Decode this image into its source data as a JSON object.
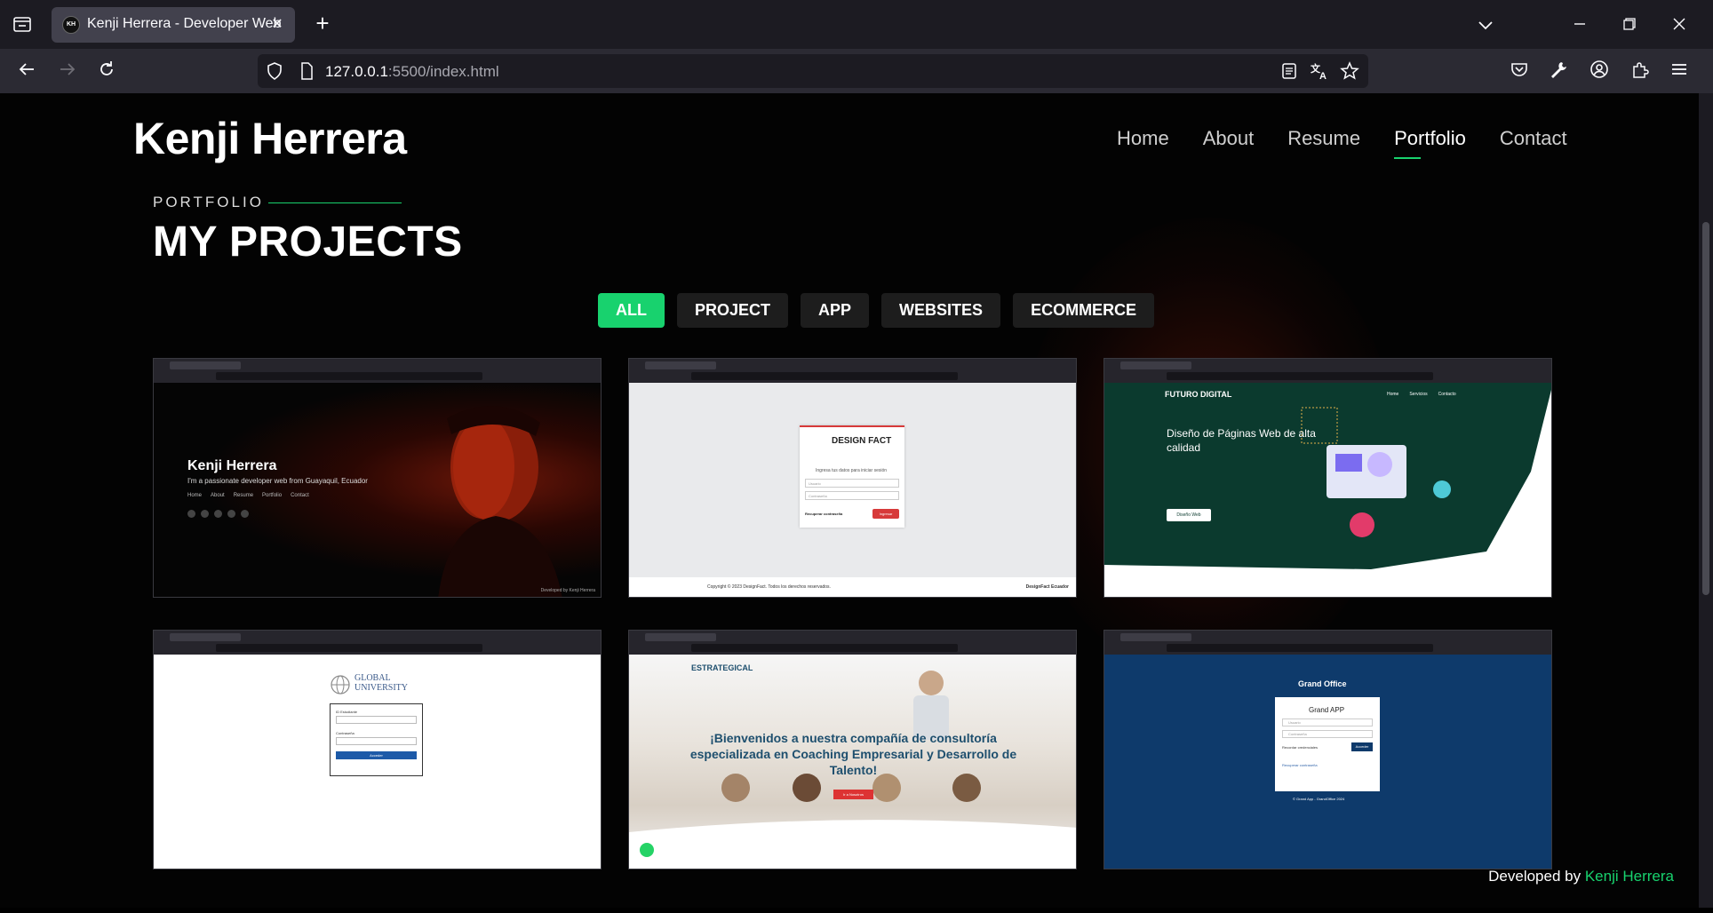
{
  "browser": {
    "tab_title": "Kenji Herrera - Developer Web",
    "favicon_text": "KH",
    "url_host": "127.0.0.1",
    "url_path": ":5500/index.html"
  },
  "site": {
    "brand": "Kenji Herrera",
    "nav": [
      "Home",
      "About",
      "Resume",
      "Portfolio",
      "Contact"
    ],
    "active_nav": "Portfolio"
  },
  "portfolio": {
    "subtitle": "PORTFOLIO",
    "title": "MY PROJECTS",
    "filters": [
      "ALL",
      "PROJECT",
      "APP",
      "WEBSITES",
      "ECOMMERCE"
    ],
    "active_filter": "ALL"
  },
  "projects": [
    {
      "name": "Kenji Herrera",
      "tagline": "I'm a passionate developer web from Guayaquil, Ecuador",
      "links": [
        "Home",
        "About",
        "Resume",
        "Portfolio",
        "Contact"
      ],
      "credit": "Developed by Kenji Herrera"
    },
    {
      "logo": "DESIGN FACT",
      "prompt": "Ingresa tus datos para iniciar sesión",
      "user": "Usuario",
      "password": "Contraseña",
      "recover": "Recuperar contraseña",
      "submit": "Ingresar",
      "footer": "Copyright © 2023 DesignFact. Todos los derechos reservados.",
      "footer_right": "DesignFact Ecuador"
    },
    {
      "logo": "FUTURO DIGITAL",
      "menu": [
        "Home",
        "Servicios",
        "Contacto"
      ],
      "headline": "Diseño de Páginas Web de alta calidad",
      "cta": "Diseño Web"
    },
    {
      "logo": "GLOBAL UNIVERSITY",
      "field1": "ID Estudiante",
      "field2": "Contraseña",
      "submit": "Acceder"
    },
    {
      "logo": "ESTRATEGICAL",
      "headline": "¡Bienvenidos a nuestra compañía de consultoría especializada en Coaching Empresarial y Desarrollo de Talento!",
      "cta": "Ir a Nosotros"
    },
    {
      "logo": "Grand Office",
      "heading": "Grand APP",
      "user": "Usuario",
      "password": "Contraseña",
      "remember": "Recordar credenciales",
      "submit": "Acceder",
      "recover": "Recuperar contraseña",
      "footer": "© Grand App - GrandOffice 2024"
    }
  ],
  "footer": {
    "prefix": "Developed by",
    "name": "Kenji Herrera"
  },
  "colors": {
    "accent": "#18d26e",
    "browser_bg": "#1c1b22",
    "navbar_bg": "#2b2a33"
  }
}
